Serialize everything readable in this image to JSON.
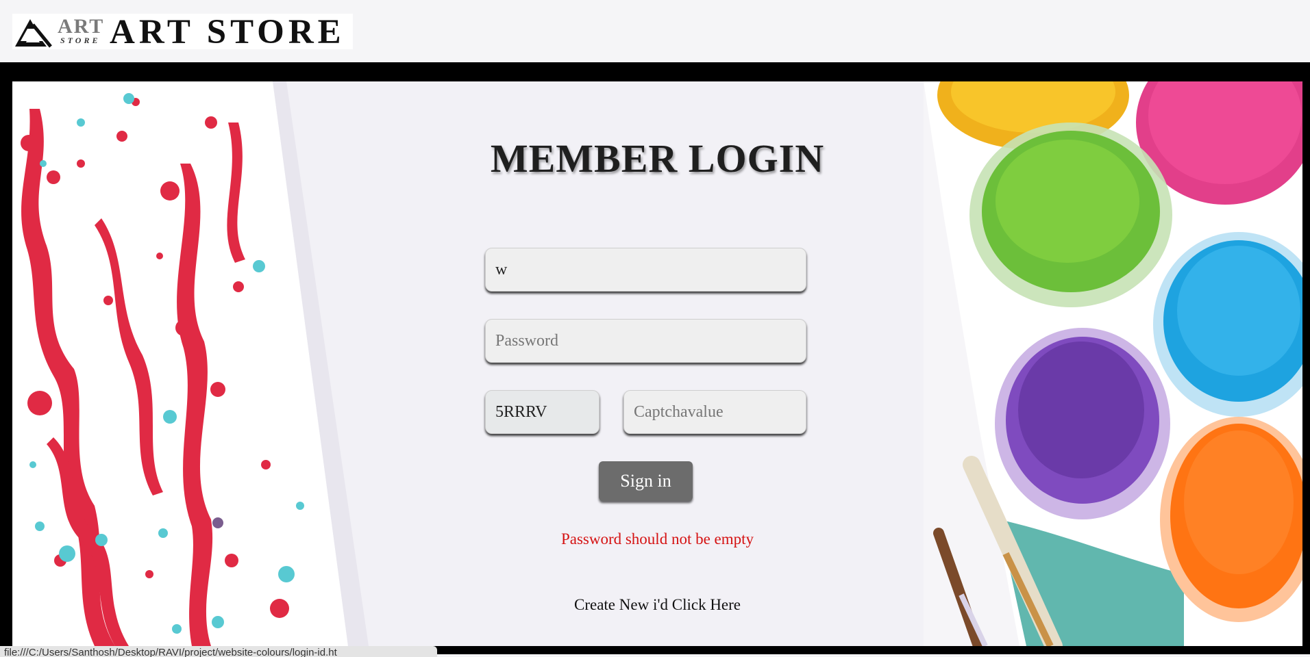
{
  "header": {
    "logo_small_art": "ART",
    "logo_small_store": "STORE",
    "logo_title": "ART STORE"
  },
  "login": {
    "title": "MEMBER LOGIN",
    "username_value": "w",
    "password_placeholder": "Password",
    "captcha_code": "5RRRV",
    "captcha_placeholder": "Captchavalue",
    "signin_label": "Sign in",
    "error_message": "Password should not be empty",
    "create_prefix": "Create New i'd ",
    "create_link": "Click Here"
  },
  "statusbar": {
    "url": "file:///C:/Users/Santhosh/Desktop/RAVI/project/website-colours/login-id.ht"
  },
  "colors": {
    "error": "#d51212",
    "button": "#6c6c6c",
    "background_band": "#000000"
  },
  "icons": [
    "art-store-logo-icon",
    "paint-splatter-image",
    "paint-pots-image"
  ]
}
